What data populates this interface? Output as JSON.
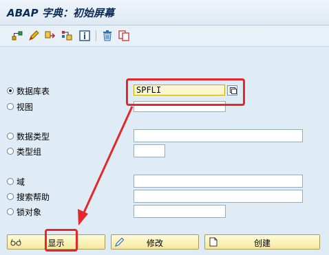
{
  "window": {
    "title": "ABAP 字典：初始屏幕"
  },
  "toolbar": {
    "items": [
      {
        "icon": "hierarchy-icon"
      },
      {
        "icon": "pencil-edit-icon"
      },
      {
        "icon": "copy-object-icon"
      },
      {
        "icon": "where-used-icon"
      },
      {
        "icon": "info-icon"
      },
      {
        "icon": "trash-delete-icon"
      },
      {
        "icon": "document-copy-icon"
      }
    ]
  },
  "form": {
    "database_table": {
      "label": "数据库表",
      "value": "SPFLI",
      "selected": true
    },
    "view": {
      "label": "视图",
      "value": ""
    },
    "data_type": {
      "label": "数据类型",
      "value": ""
    },
    "type_group": {
      "label": "类型组",
      "value": ""
    },
    "domain": {
      "label": "域",
      "value": ""
    },
    "search_help": {
      "label": "搜索帮助",
      "value": ""
    },
    "lock_object": {
      "label": "锁对象",
      "value": ""
    }
  },
  "buttons": {
    "display": "显示",
    "change": "修改",
    "create": "创建"
  },
  "colors": {
    "background": "#dfebf5",
    "title": "#0b2c58",
    "annotation": "#e5262a",
    "button": "#f5e99c",
    "active_field": "#fdf7d0"
  }
}
